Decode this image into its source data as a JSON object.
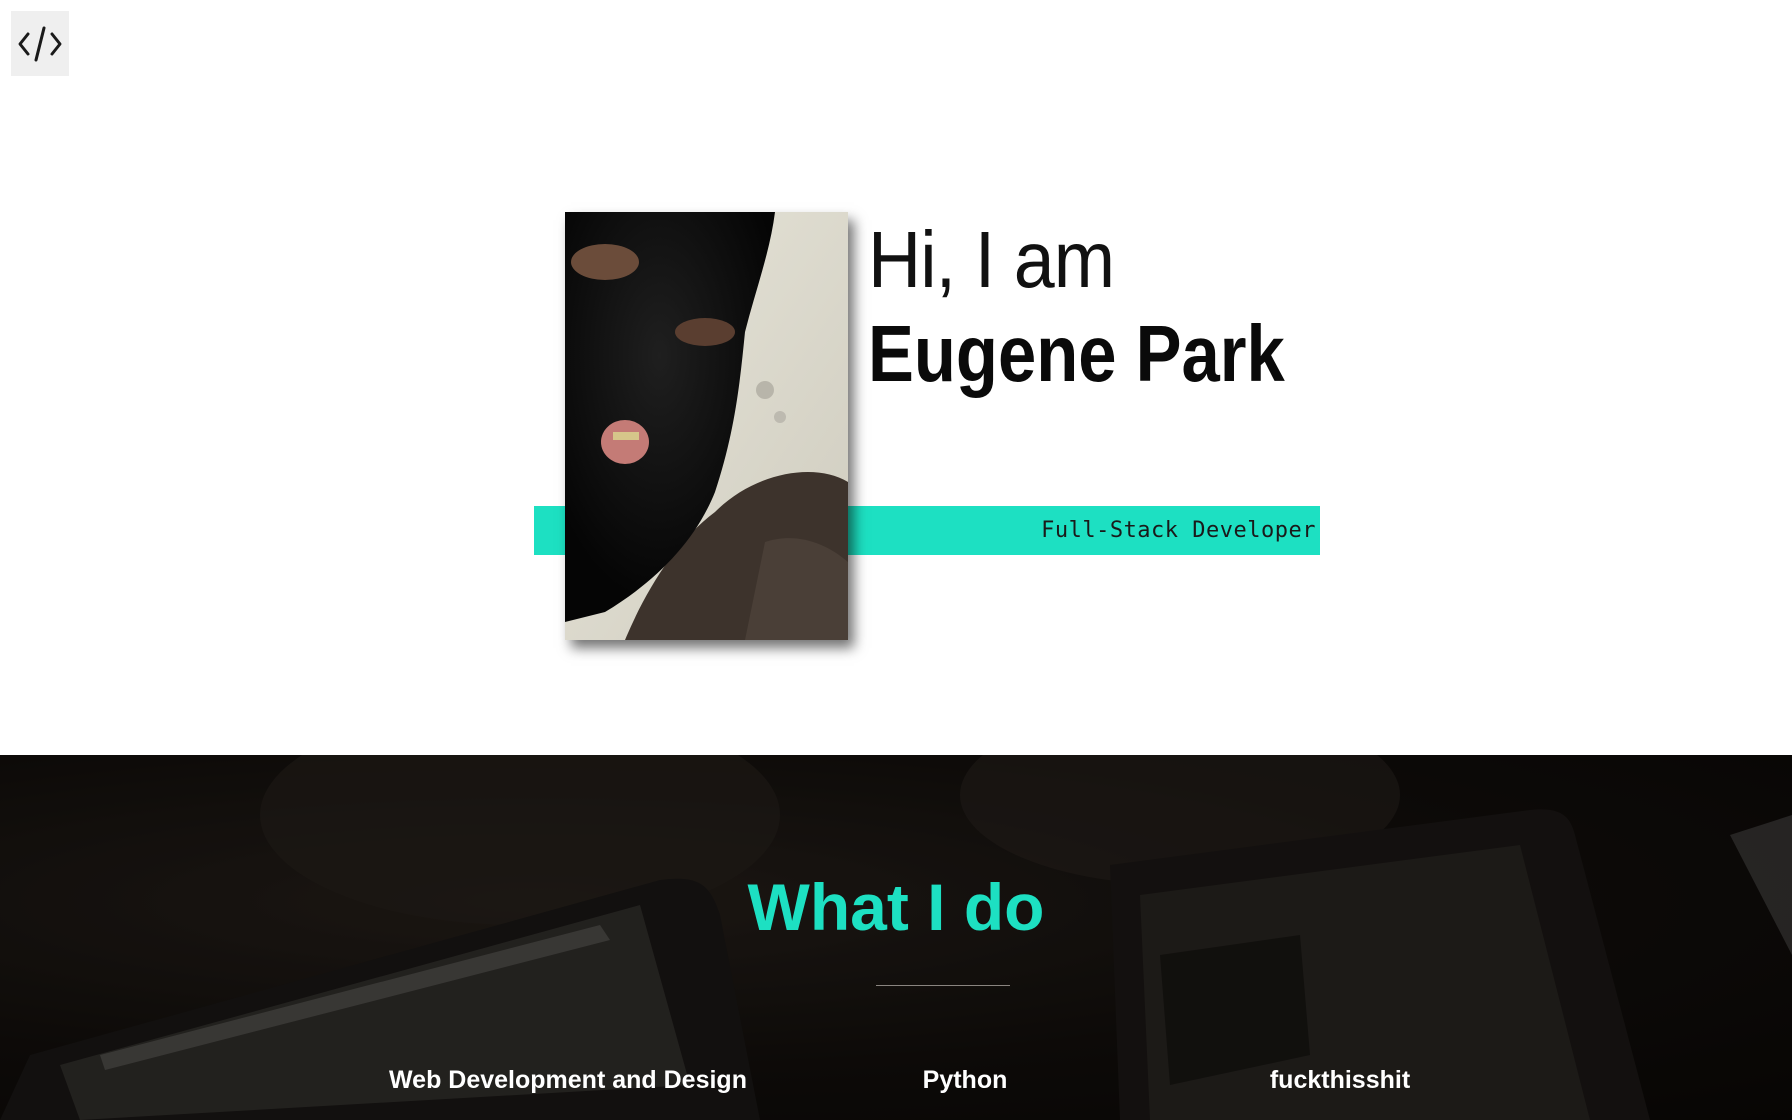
{
  "header": {
    "logo_icon": "code-icon"
  },
  "hero": {
    "greeting": "Hi, I am",
    "name": "Eugene Park",
    "role": "Full-Stack Developer",
    "accent_color": "#1de0c2"
  },
  "what_i_do": {
    "title": "What I do",
    "services": [
      {
        "label": "Web Development and Design"
      },
      {
        "label": "Python"
      },
      {
        "label": "fuckthisshit"
      }
    ]
  }
}
